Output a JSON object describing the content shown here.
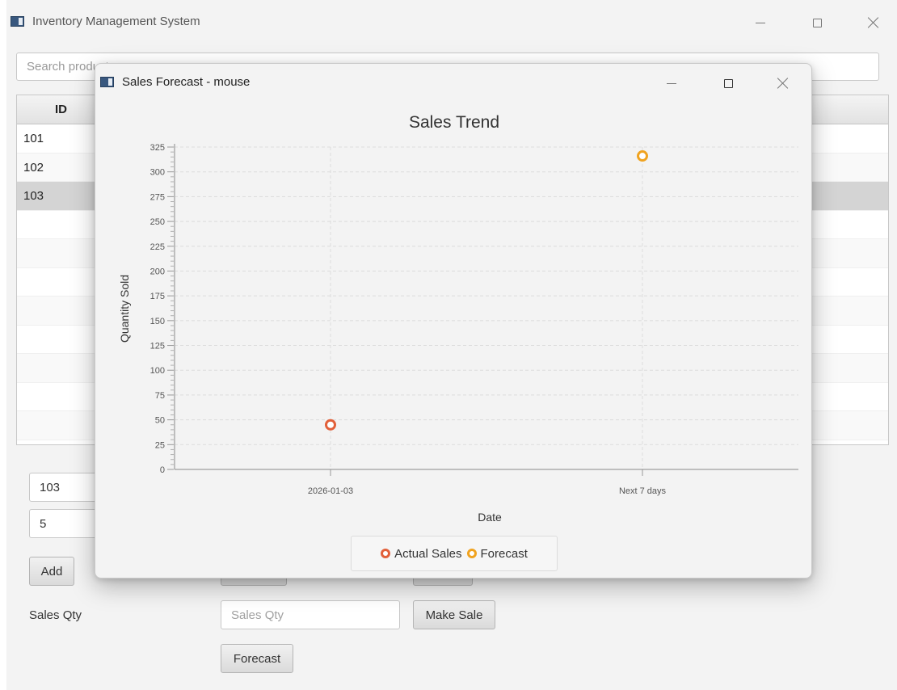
{
  "app": {
    "title": "Inventory Management System",
    "controls": {
      "minimize": "—",
      "maximize": "☐",
      "close": "✕"
    }
  },
  "search": {
    "placeholder": "Search products..."
  },
  "table": {
    "columns": [
      "ID"
    ],
    "rows": [
      "101",
      "102",
      "103"
    ],
    "selected_index": 2
  },
  "form": {
    "id_value": "103",
    "qty_value": "5",
    "add_label": "Add",
    "sales_qty_label": "Sales Qty",
    "sales_qty_placeholder": "Sales Qty",
    "make_sale_label": "Make Sale",
    "forecast_label": "Forecast"
  },
  "dialog": {
    "title": "Sales Forecast - mouse"
  },
  "colors": {
    "actual": "#e2603a",
    "forecast": "#f0a320"
  },
  "chart_data": {
    "type": "scatter",
    "title": "Sales Trend",
    "xlabel": "Date",
    "ylabel": "Quantity Sold",
    "categories": [
      "2026-01-03",
      "Next 7 days"
    ],
    "ylim": [
      0,
      325
    ],
    "yticks": [
      0,
      25,
      50,
      75,
      100,
      125,
      150,
      175,
      200,
      225,
      250,
      275,
      300,
      325
    ],
    "grid": true,
    "legend_position": "bottom",
    "series": [
      {
        "name": "Actual Sales",
        "points": [
          {
            "x": "2026-01-03",
            "y": 45
          }
        ]
      },
      {
        "name": "Forecast",
        "points": [
          {
            "x": "Next 7 days",
            "y": 316
          }
        ]
      }
    ]
  }
}
